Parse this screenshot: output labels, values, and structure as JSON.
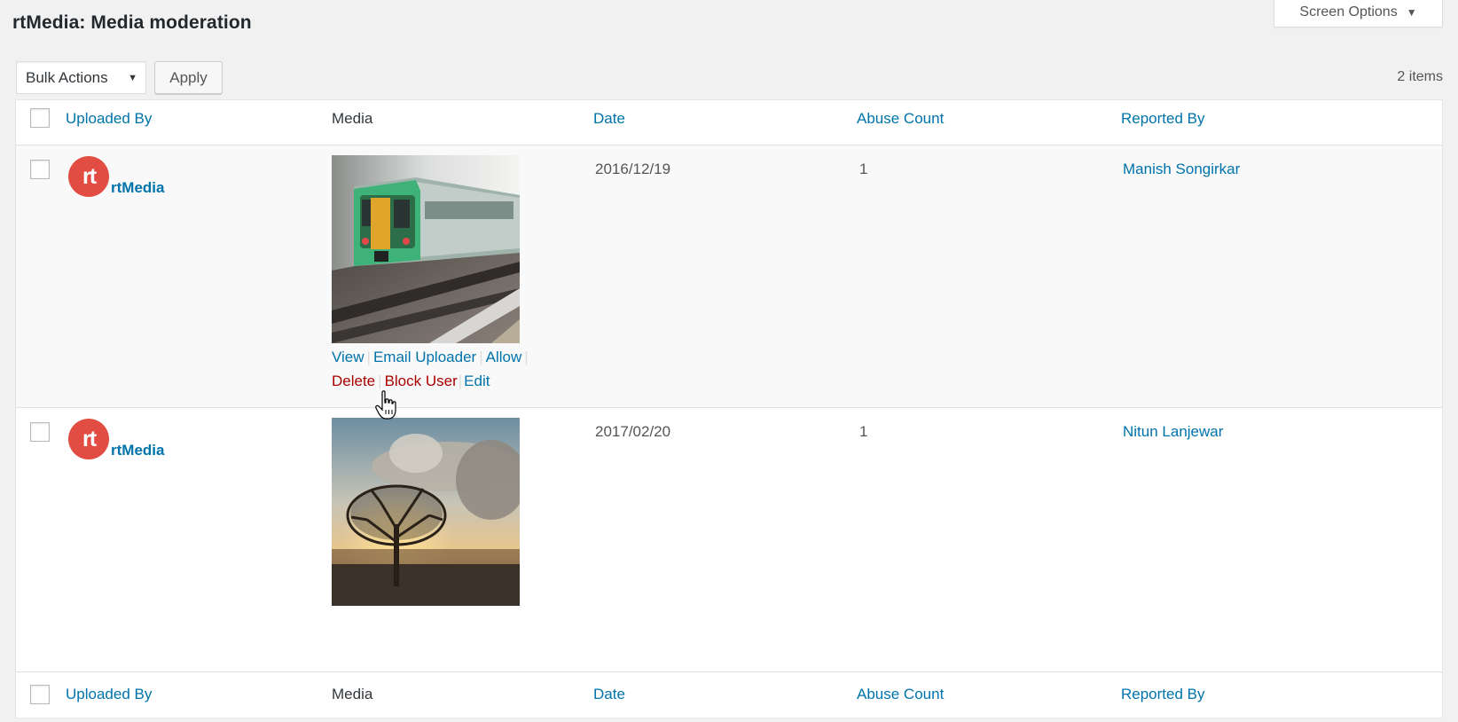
{
  "page": {
    "title": "rtMedia: Media moderation",
    "screen_options_label": "Screen Options",
    "items_count": "2 items"
  },
  "toolbar": {
    "bulk_actions_selected": "Bulk Actions",
    "apply_label": "Apply"
  },
  "table": {
    "columns": [
      "Uploaded By",
      "Media",
      "Date",
      "Abuse Count",
      "Reported By"
    ],
    "rows": [
      {
        "uploader": "rtMedia",
        "avatar_text": "rt",
        "media": "train-photo",
        "date": "2016/12/19",
        "abuse_count": "1",
        "reported_by": "Manish Songirkar",
        "actions": {
          "view": "View",
          "email": "Email Uploader",
          "allow": "Allow",
          "delete": "Delete",
          "block": "Block User",
          "edit": "Edit"
        }
      },
      {
        "uploader": "rtMedia",
        "avatar_text": "rt",
        "media": "tree-sunset-photo",
        "date": "2017/02/20",
        "abuse_count": "1",
        "reported_by": "Nitun Lanjewar"
      }
    ]
  },
  "colors": {
    "link": "#0073aa",
    "danger": "#a00",
    "avatar": "#e14d43",
    "background": "#f1f1f1"
  }
}
